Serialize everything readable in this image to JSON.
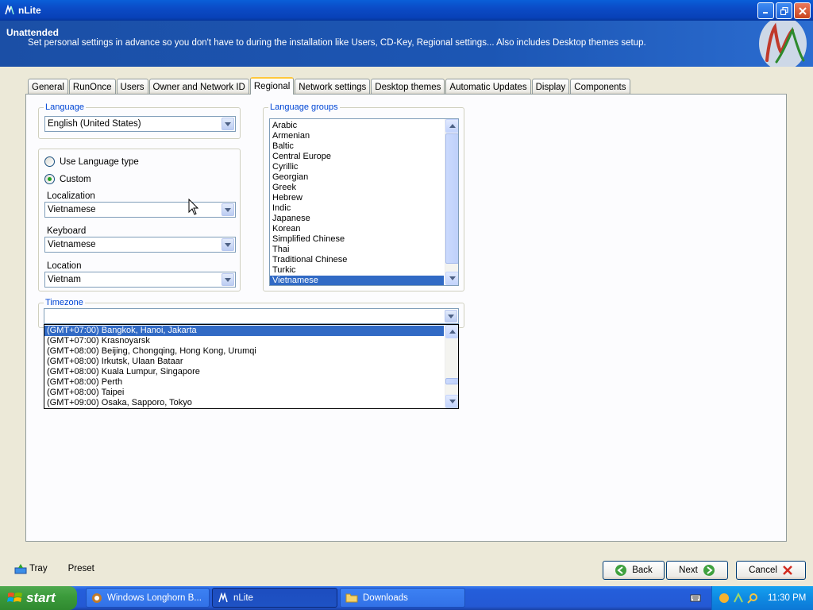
{
  "window": {
    "title": "nLite"
  },
  "header": {
    "title": "Unattended",
    "description": "Set personal settings in advance so you don't have to during the installation like Users, CD-Key, Regional settings... Also includes Desktop themes setup."
  },
  "tabs": [
    {
      "label": "General"
    },
    {
      "label": "RunOnce"
    },
    {
      "label": "Users"
    },
    {
      "label": "Owner and Network ID"
    },
    {
      "label": "Regional"
    },
    {
      "label": "Network settings"
    },
    {
      "label": "Desktop themes"
    },
    {
      "label": "Automatic Updates"
    },
    {
      "label": "Display"
    },
    {
      "label": "Components"
    }
  ],
  "active_tab": "Regional",
  "language": {
    "group_label": "Language",
    "value": "English (United States)"
  },
  "locale": {
    "radio_language_type": "Use Language type",
    "radio_custom": "Custom",
    "selected_radio": "Custom",
    "localization_label": "Localization",
    "localization_value": "Vietnamese",
    "keyboard_label": "Keyboard",
    "keyboard_value": "Vietnamese",
    "location_label": "Location",
    "location_value": "Vietnam"
  },
  "language_groups": {
    "group_label": "Language groups",
    "items": [
      "Arabic",
      "Armenian",
      "Baltic",
      "Central Europe",
      "Cyrillic",
      "Georgian",
      "Greek",
      "Hebrew",
      "Indic",
      "Japanese",
      "Korean",
      "Simplified Chinese",
      "Thai",
      "Traditional Chinese",
      "Turkic",
      "Vietnamese"
    ],
    "selected": "Vietnamese"
  },
  "timezone": {
    "group_label": "Timezone",
    "value": "",
    "items": [
      "(GMT+07:00) Bangkok, Hanoi, Jakarta",
      "(GMT+07:00) Krasnoyarsk",
      "(GMT+08:00) Beijing, Chongqing, Hong Kong, Urumqi",
      "(GMT+08:00) Irkutsk, Ulaan Bataar",
      "(GMT+08:00) Kuala Lumpur, Singapore",
      "(GMT+08:00) Perth",
      "(GMT+08:00) Taipei",
      "(GMT+09:00) Osaka, Sapporo, Tokyo"
    ],
    "selected": "(GMT+07:00) Bangkok, Hanoi, Jakarta"
  },
  "footer": {
    "tray": "Tray",
    "preset": "Preset",
    "back": "Back",
    "next": "Next",
    "cancel": "Cancel"
  },
  "taskbar": {
    "start": "start",
    "tasks": [
      "Windows Longhorn B...",
      "nLite",
      "Downloads"
    ],
    "active_task": "nLite",
    "clock": "11:30 PM"
  },
  "colors": {
    "accent": "#316ac5",
    "header_bg": "#1c56b4",
    "group_label": "#0046d5"
  }
}
